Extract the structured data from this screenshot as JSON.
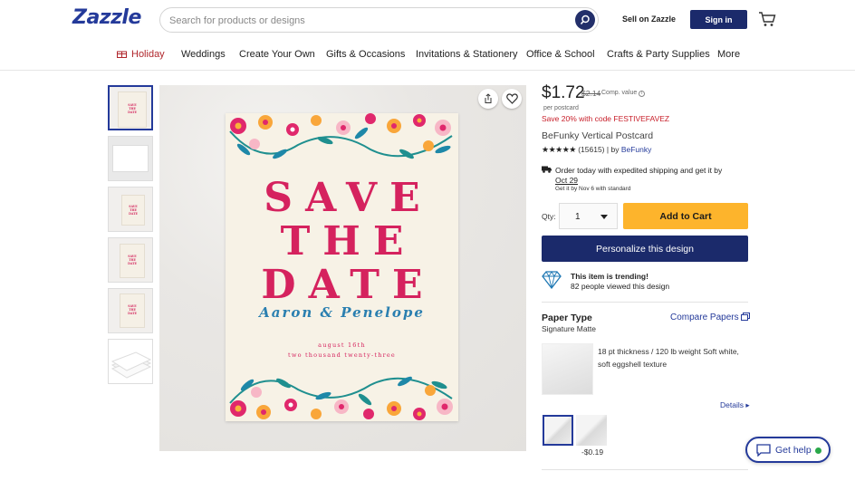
{
  "header": {
    "logo": "Zazzle",
    "search_placeholder": "Search for products or designs",
    "sell_label": "Sell on Zazzle",
    "signin_label": "Sign in"
  },
  "nav": {
    "items": [
      "Holiday",
      "Weddings",
      "Create Your Own",
      "Gifts & Occasions",
      "Invitations & Stationery",
      "Office & School",
      "Crafts & Party Supplies",
      "More"
    ]
  },
  "card": {
    "line1": "SAVE",
    "line2": "THE",
    "line3": "DATE",
    "names": "Aaron & Penelope",
    "date_line": "august 16th",
    "year_line": "two thousand twenty-three"
  },
  "thumb_card": {
    "line1": "SAVE",
    "line2": "THE",
    "line3": "DATE"
  },
  "product": {
    "price": "$1.72",
    "original_price": "$2.14",
    "comp_value": "Comp. value",
    "per_unit": "per postcard",
    "promo": "Save 20% with code FESTIVEFAVEZ",
    "name": "BeFunky Vertical Postcard",
    "stars": "★★★★★",
    "review_count": "(15615)",
    "by_label": "| by",
    "seller": "BeFunky"
  },
  "shipping": {
    "line1": "Order today with expedited shipping and get it by",
    "date": "Oct 29",
    "standard": "Get it by Nov 6 with standard"
  },
  "purchase": {
    "qty_label": "Qty:",
    "qty_value": "1",
    "add_to_cart": "Add to Cart",
    "personalize": "Personalize this design"
  },
  "trending": {
    "title": "This item is trending!",
    "subtitle": "82 people viewed this design"
  },
  "paper": {
    "section_title": "Paper Type",
    "compare_label": "Compare Papers",
    "selected": "Signature Matte",
    "description": "18 pt thickness / 120 lb weight Soft white, soft eggshell texture",
    "details_label": "Details ▸",
    "swatch2_price": "-$0.19"
  },
  "help": {
    "label": "Get help"
  },
  "colors": {
    "brand_navy": "#1b2a6b",
    "accent_yellow": "#fdb42c",
    "promo_red": "#c8202b",
    "card_pink": "#d5225e",
    "card_blue": "#2a7fb0"
  }
}
